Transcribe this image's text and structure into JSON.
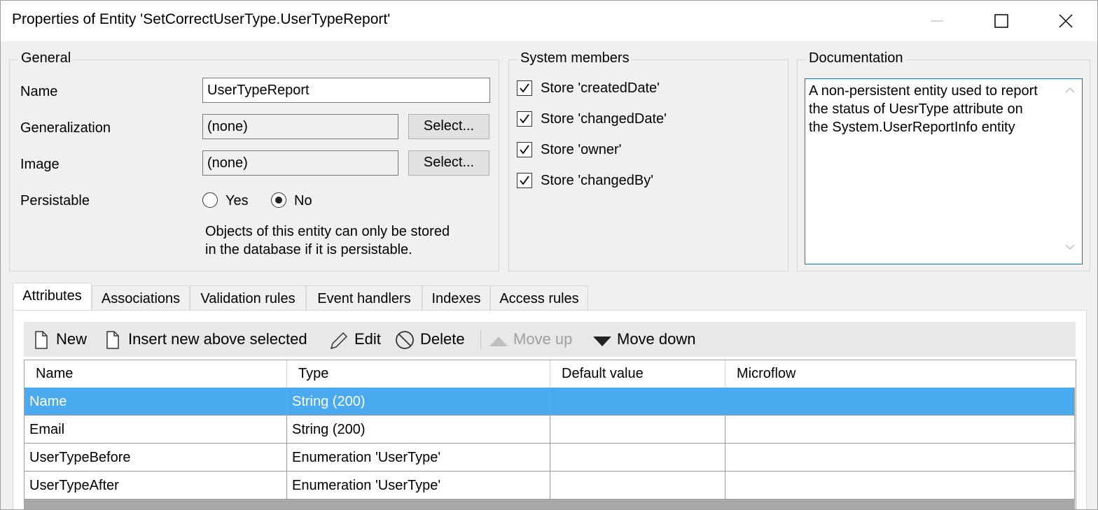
{
  "window": {
    "title": "Properties of Entity 'SetCorrectUserType.UserTypeReport'"
  },
  "general": {
    "legend": "General",
    "name_label": "Name",
    "name_value": "UserTypeReport",
    "generalization_label": "Generalization",
    "generalization_value": "(none)",
    "generalization_button": "Select...",
    "image_label": "Image",
    "image_value": "(none)",
    "image_button": "Select...",
    "persistable_label": "Persistable",
    "persistable_yes": "Yes",
    "persistable_no": "No",
    "persistable_selected": "No",
    "note_line1": "Objects of this entity can only be stored",
    "note_line2": "in the database if it is persistable."
  },
  "system_members": {
    "legend": "System members",
    "items": [
      {
        "label": "Store 'createdDate'",
        "checked": true
      },
      {
        "label": "Store 'changedDate'",
        "checked": true
      },
      {
        "label": "Store 'owner'",
        "checked": true
      },
      {
        "label": "Store 'changedBy'",
        "checked": true
      }
    ]
  },
  "documentation": {
    "legend": "Documentation",
    "line1": "A non-persistent entity used to report",
    "line2": "the status of UesrType attribute on",
    "line3": "the System.UserReportInfo entity"
  },
  "tabs": [
    {
      "label": "Attributes",
      "active": true
    },
    {
      "label": "Associations"
    },
    {
      "label": "Validation rules"
    },
    {
      "label": "Event handlers"
    },
    {
      "label": "Indexes"
    },
    {
      "label": "Access rules"
    }
  ],
  "toolbar": {
    "new": "New",
    "insert_above": "Insert new above selected",
    "edit": "Edit",
    "delete": "Delete",
    "move_up": "Move up",
    "move_down": "Move down"
  },
  "attributes": {
    "columns": [
      "Name",
      "Type",
      "Default value",
      "Microflow"
    ],
    "rows": [
      {
        "name": "Name",
        "type": "String (200)",
        "default": "",
        "microflow": "",
        "selected": true
      },
      {
        "name": "Email",
        "type": "String (200)",
        "default": "",
        "microflow": ""
      },
      {
        "name": "UserTypeBefore",
        "type": "Enumeration 'UserType'",
        "default": "",
        "microflow": ""
      },
      {
        "name": "UserTypeAfter",
        "type": "Enumeration 'UserType'",
        "default": "",
        "microflow": ""
      }
    ]
  },
  "colors": {
    "selection": "#4aaaf0",
    "focus_border": "#0078d7"
  }
}
